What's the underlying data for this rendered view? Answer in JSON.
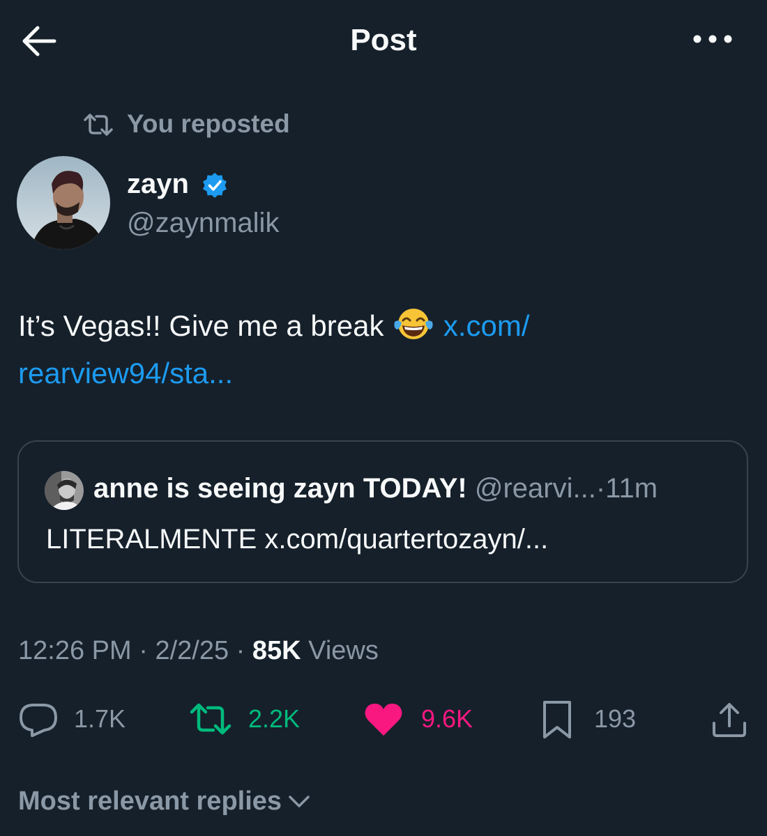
{
  "header": {
    "back_icon": "arrow-left-icon",
    "title": "Post",
    "more_icon": "more-horizontal-icon"
  },
  "repost": {
    "icon": "repost-icon",
    "label": "You reposted"
  },
  "author": {
    "display_name": "zayn",
    "handle": "@zaynmalik",
    "verified": true,
    "verified_color": "#1d9bf0"
  },
  "post": {
    "text_before": "It’s Vegas!! Give me a break",
    "emoji": "face-with-tears-of-joy",
    "link_line1": "x.com/",
    "link_line2": "rearview94/sta..."
  },
  "quote": {
    "display_name": "anne is seeing zayn TODAY!",
    "handle": "@rearvi...",
    "separator": "·",
    "time": "11m",
    "text": "LITERALMENTE x.com/quartertozayn/..."
  },
  "meta": {
    "time": "12:26 PM",
    "sep1": "·",
    "date": "2/2/25",
    "sep2": "·",
    "views_count": "85K",
    "views_label": "Views"
  },
  "actions": {
    "replies": "1.7K",
    "reposts": "2.2K",
    "likes": "9.6K",
    "bookmarks": "193"
  },
  "colors": {
    "background": "#15202b",
    "accent": "#1d9bf0",
    "repost_green": "#00ba7c",
    "like_pink": "#f91880",
    "secondary_text": "#8b98a5",
    "border": "#38444d"
  },
  "replies_sort": {
    "label": "Most relevant replies",
    "icon": "chevron-down-icon"
  }
}
